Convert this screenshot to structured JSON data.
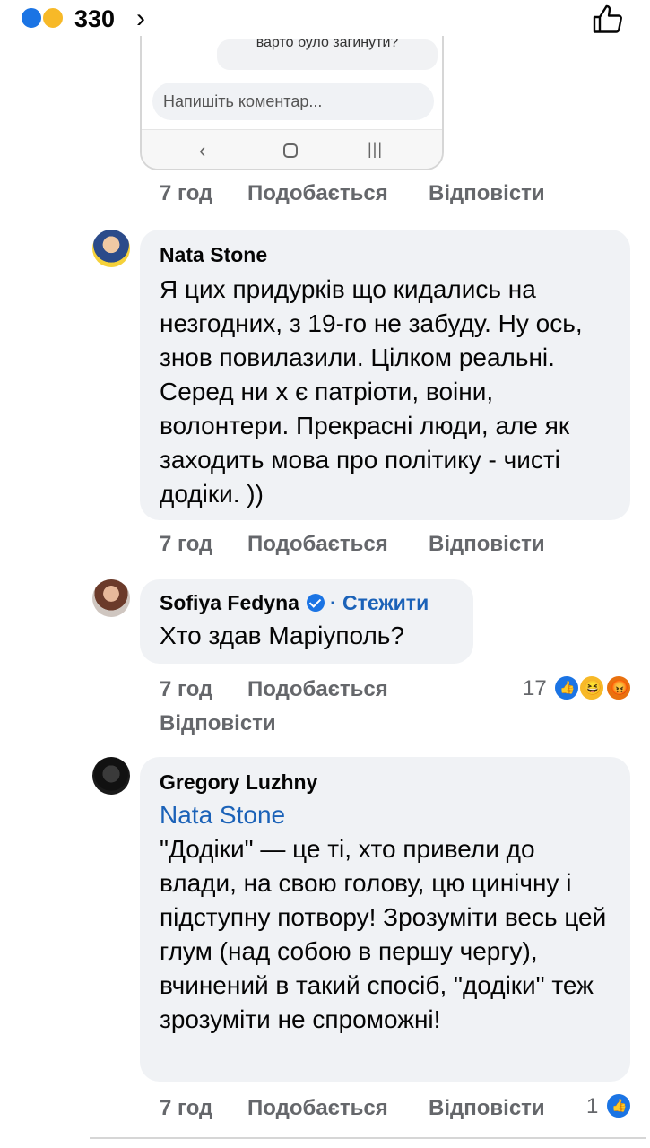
{
  "header": {
    "reaction_count": "330",
    "reaction_icons": [
      "like-icon",
      "care-icon"
    ],
    "chevron_icon": "chevron-right-icon",
    "like_icon": "thumbs-up-icon"
  },
  "embedded_screenshot": {
    "cut_text": "варто було загинути?",
    "comment_placeholder": "Напишіть коментар...",
    "nav": {
      "back": "‹",
      "home": "home-icon",
      "recent": "|||"
    }
  },
  "actions_common": {
    "like": "Подобається",
    "reply": "Відповісти"
  },
  "comment0_actions": {
    "time": "7 год"
  },
  "comments": [
    {
      "author": "Nata Stone",
      "text": "Я цих придурків що кидались на незгодних, з 19-го не забуду. Ну ось, знов повилазили. Цілком реальні. Серед ни х є патріоти, воіни, волонтери. Прекрасні люди, але як заходить мова про політику - чисті додіки. ))",
      "time": "7 год"
    },
    {
      "author": "Sofiya Fedyna",
      "follow": "Стежити",
      "separator": "·",
      "text": "Хто здав Маріуполь?",
      "time": "7 год",
      "reactions_count": "17",
      "reactions": [
        "like-icon",
        "haha-icon",
        "angry-icon"
      ]
    },
    {
      "author": "Gregory Luzhny",
      "mention": "Nata Stone",
      "text": "\"Додіки\" — це ті, хто привели до влади, на свою голову, цю цинічну і підступну потвору! Зрозуміти весь цей глум (над собою в першу чергу), вчинений в такий спосіб, \"додіки\" теж зрозуміти не спроможні!",
      "time": "7 год",
      "reactions_count": "1",
      "reactions": [
        "like-icon"
      ]
    }
  ],
  "colors": {
    "bubble": "#f0f2f5",
    "meta_text": "#65676b",
    "link_blue": "#1b62b8",
    "facebook_blue": "#1b74e4"
  }
}
